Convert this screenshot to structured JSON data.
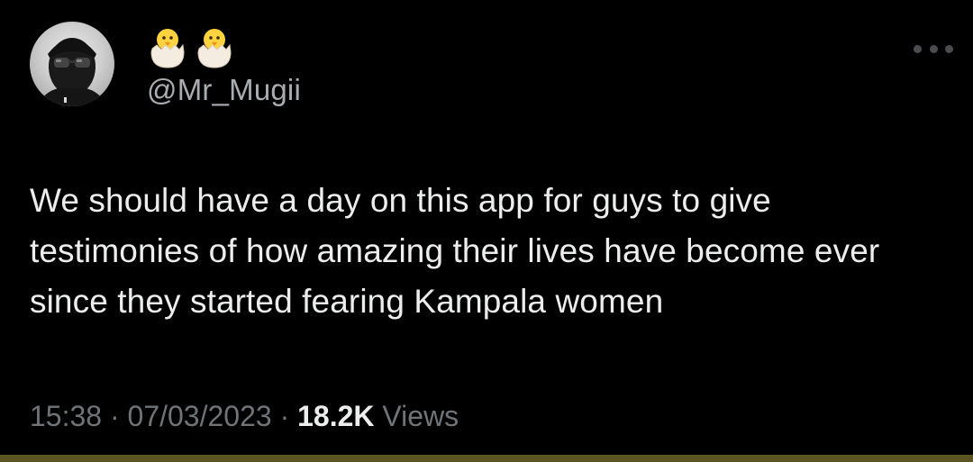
{
  "author": {
    "display_name_icons": [
      "hatching-chick-icon",
      "hatching-chick-icon"
    ],
    "handle": "@Mr_Mugii"
  },
  "tweet": {
    "text": "We should have a day on this app for guys to give testimonies of how amazing their lives have become ever since they started fearing Kampala women",
    "time": "15:38",
    "separator": "·",
    "date": "07/03/2023",
    "views_count": "18.2K",
    "views_label": "Views"
  },
  "colors": {
    "background": "#000000",
    "text": "#eceded",
    "secondary_text": "#6f7479",
    "handle_text": "#a9adb1",
    "bottom_strip": "#5a5322"
  }
}
